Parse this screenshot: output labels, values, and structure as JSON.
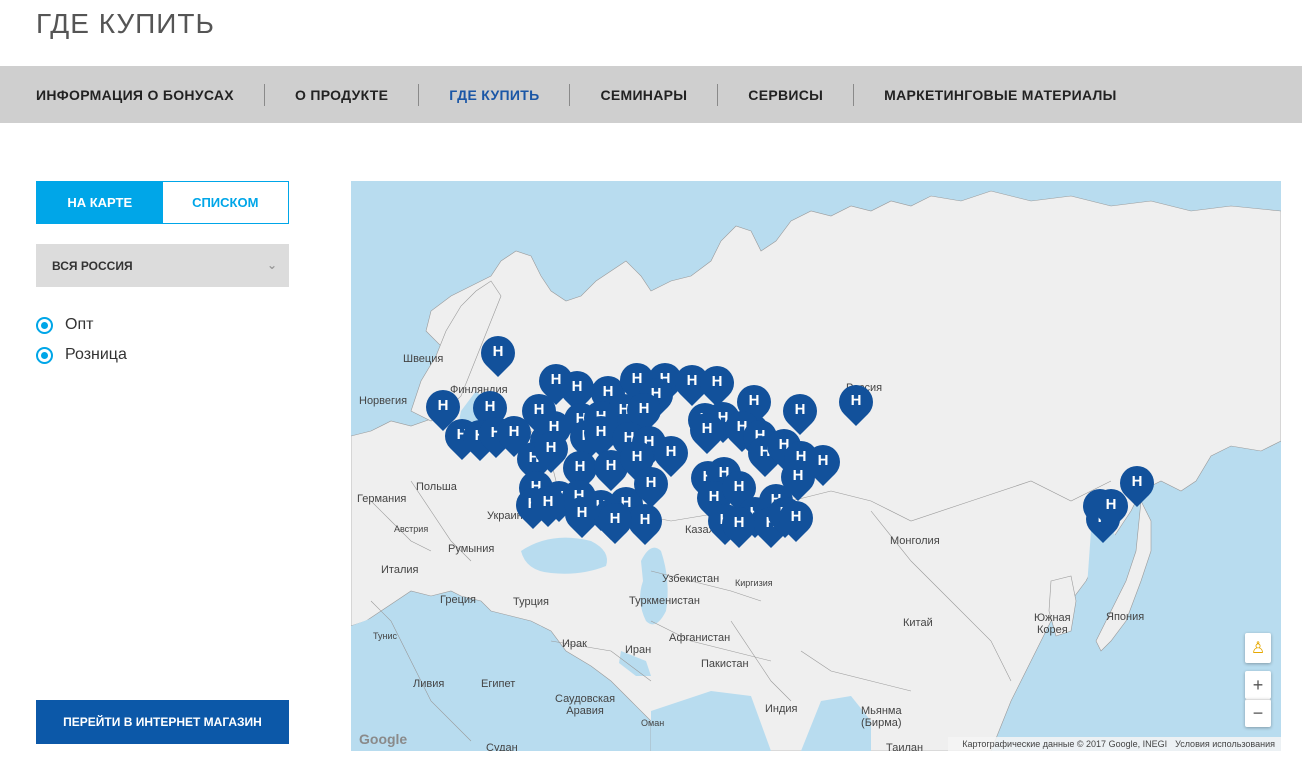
{
  "page": {
    "title": "ГДЕ КУПИТЬ"
  },
  "nav": {
    "items": [
      {
        "label": "ИНФОРМАЦИЯ О БОНУСАХ",
        "active": false
      },
      {
        "label": "О ПРОДУКТЕ",
        "active": false
      },
      {
        "label": "ГДЕ КУПИТЬ",
        "active": true
      },
      {
        "label": "СЕМИНАРЫ",
        "active": false
      },
      {
        "label": "СЕРВИСЫ",
        "active": false
      },
      {
        "label": "МАРКЕТИНГОВЫЕ МАТЕРИАЛЫ",
        "active": false
      }
    ],
    "active_color": "#1a56a6"
  },
  "view_toggle": {
    "map_label": "НА КАРТЕ",
    "list_label": "СПИСКОМ",
    "selected": "map",
    "accent": "#00a6e8"
  },
  "region": {
    "selected": "ВСЯ РОССИЯ"
  },
  "filters": [
    {
      "label": "Опт",
      "checked": true
    },
    {
      "label": "Розница",
      "checked": true
    }
  ],
  "shop_button": {
    "label": "ПЕРЕЙТИ В ИНТЕРНЕТ МАГАЗИН",
    "color": "#0c58a8"
  },
  "map": {
    "pin_letter": "H",
    "pin_color": "#12519b",
    "labels": {
      "russia": "Россия",
      "sweden": "Швеция",
      "finland": "Финляндия",
      "norway": "Норвегия",
      "germany": "Германия",
      "poland": "Польша",
      "ukraine": "Украина",
      "austria": "Австрия",
      "romania": "Румыния",
      "italy": "Италия",
      "greece": "Греция",
      "turkey": "Турция",
      "tunisia": "Тунис",
      "libya": "Ливия",
      "egypt": "Египет",
      "sudan": "Судан",
      "saudi": "Саудовская\nАравия",
      "oman": "Оман",
      "iraq": "Ирак",
      "iran": "Иран",
      "kazakhstan": "Казахстан",
      "uzbekistan": "Узбекистан",
      "turkmenistan": "Туркменистан",
      "kyrgyzstan": "Киргизия",
      "afghanistan": "Афганистан",
      "pakistan": "Пакистан",
      "india": "Индия",
      "myanmar": "Мьянма\n(Бирма)",
      "thailand": "Таилан",
      "mongolia": "Монголия",
      "china": "Китай",
      "korea": "Южная\nКорея",
      "japan": "Япония"
    },
    "attribution": "Картографические данные © 2017 Google, INEGI",
    "terms": "Условия использования",
    "google": "Google",
    "zoom_in": "+",
    "zoom_out": "−",
    "pegman_icon": "pegman-icon"
  }
}
